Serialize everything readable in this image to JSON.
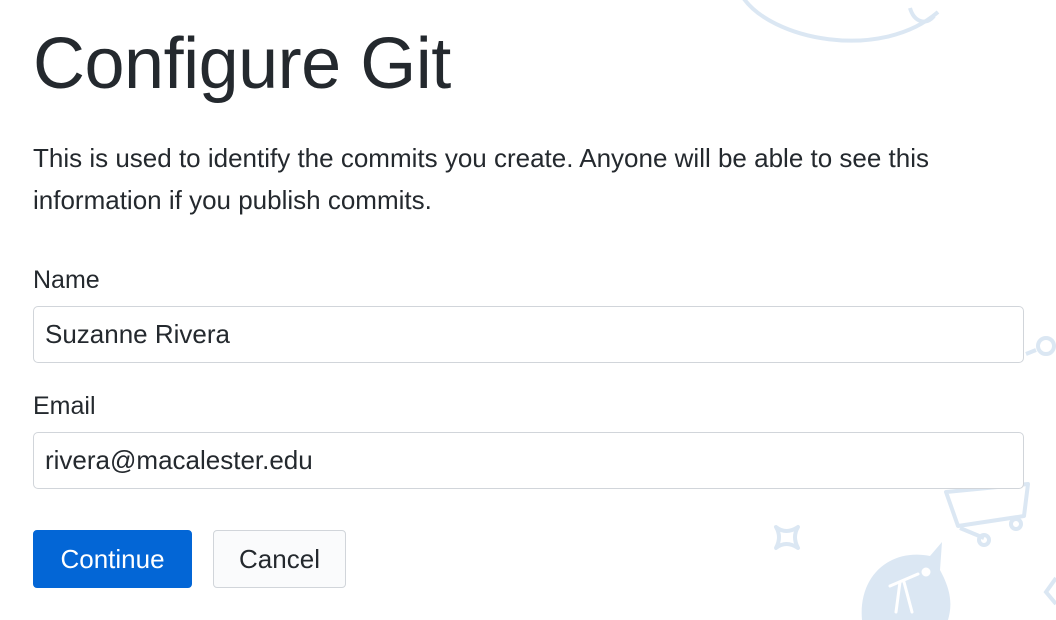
{
  "page": {
    "title": "Configure Git",
    "description": "This is used to identify the commits you create. Anyone will be able to see this information if you publish commits."
  },
  "form": {
    "name_label": "Name",
    "name_value": "Suzanne Rivera",
    "email_label": "Email",
    "email_value": "rivera@macalester.edu"
  },
  "actions": {
    "continue_label": "Continue",
    "cancel_label": "Cancel"
  },
  "colors": {
    "primary": "#0366d6",
    "decoration": "#dbe7f3"
  },
  "decorations": {
    "icons": [
      "planet-icon",
      "key-icon",
      "sparkle-icon",
      "telescope-icon",
      "cart-icon",
      "arrow-icon"
    ]
  }
}
